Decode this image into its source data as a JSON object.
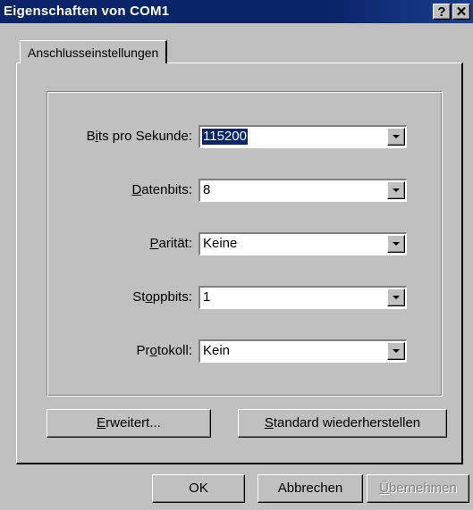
{
  "window": {
    "title": "Eigenschaften von COM1",
    "help_glyph": "?",
    "close_glyph": "✕"
  },
  "tabs": [
    {
      "label": "Anschlusseinstellungen",
      "active": true
    }
  ],
  "settings": [
    {
      "label_pre": "B",
      "label_mnemonic": "i",
      "label_post": "ts pro Sekunde:",
      "value": "115200",
      "selected": true
    },
    {
      "label_pre": "",
      "label_mnemonic": "D",
      "label_post": "atenbits:",
      "value": "8",
      "selected": false
    },
    {
      "label_pre": "",
      "label_mnemonic": "P",
      "label_post": "arität:",
      "value": "Keine",
      "selected": false
    },
    {
      "label_pre": "St",
      "label_mnemonic": "o",
      "label_post": "ppbits:",
      "value": "1",
      "selected": false
    },
    {
      "label_pre": "Pr",
      "label_mnemonic": "o",
      "label_post": "tokoll:",
      "value": "Kein",
      "selected": false
    }
  ],
  "buttons": {
    "advanced": {
      "mnemonic": "E",
      "rest": "rweitert..."
    },
    "restore_defaults": {
      "mnemonic": "S",
      "rest": "tandard wiederherstellen"
    },
    "ok": "OK",
    "cancel": "Abbrechen",
    "apply": {
      "mnemonic": "Ü",
      "rest": "bernehmen",
      "enabled": false
    }
  }
}
